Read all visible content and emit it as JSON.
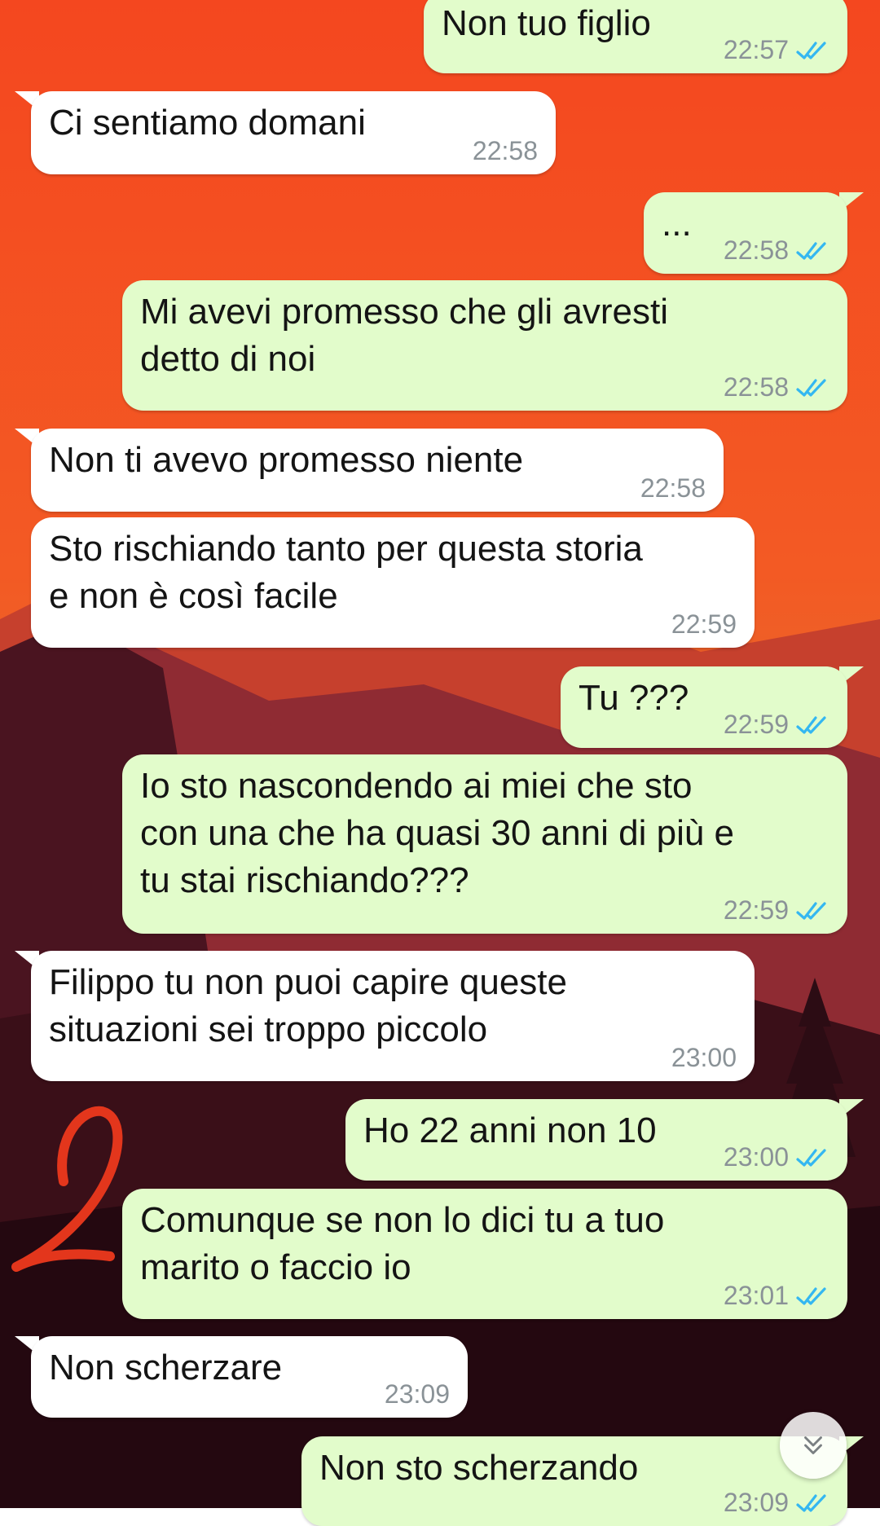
{
  "chat": {
    "colors": {
      "incoming_bubble": "#ffffff",
      "outgoing_bubble": "#e2fccb",
      "read_ticks": "#34b7f1",
      "time_text": "#8a9297"
    },
    "messages": [
      {
        "direction": "out",
        "text": "Non tuo figlio",
        "time": "22:57",
        "status": "read"
      },
      {
        "direction": "in",
        "text": "Ci sentiamo domani",
        "time": "22:58"
      },
      {
        "direction": "out",
        "text": "...",
        "time": "22:58",
        "status": "read"
      },
      {
        "direction": "out",
        "lines": [
          "Mi avevi promesso che gli avresti",
          "detto di noi"
        ],
        "time": "22:58",
        "status": "read"
      },
      {
        "direction": "in",
        "text": "Non ti avevo promesso niente",
        "time": "22:58"
      },
      {
        "direction": "in",
        "lines": [
          "Sto rischiando tanto per questa storia",
          "e non è così facile"
        ],
        "time": "22:59"
      },
      {
        "direction": "out",
        "text": "Tu ???",
        "time": "22:59",
        "status": "read"
      },
      {
        "direction": "out",
        "lines": [
          "Io sto nascondendo ai miei che sto",
          "con una che ha quasi 30 anni di più e",
          "tu stai rischiando???"
        ],
        "time": "22:59",
        "status": "read"
      },
      {
        "direction": "in",
        "lines": [
          "Filippo tu non puoi capire queste",
          "situazioni sei troppo piccolo"
        ],
        "time": "23:00"
      },
      {
        "direction": "out",
        "text": "Ho 22 anni non 10",
        "time": "23:00",
        "status": "read"
      },
      {
        "direction": "out",
        "lines": [
          "Comunque se non lo dici tu a tuo",
          "marito o faccio io"
        ],
        "time": "23:01",
        "status": "read"
      },
      {
        "direction": "in",
        "text": "Non scherzare",
        "time": "23:09"
      },
      {
        "direction": "out",
        "text": "Non sto scherzando",
        "time": "23:09",
        "status": "read"
      }
    ],
    "scroll_button_icon": "double-chevron-down-icon",
    "annotation_icon": "handwritten-number-2"
  }
}
